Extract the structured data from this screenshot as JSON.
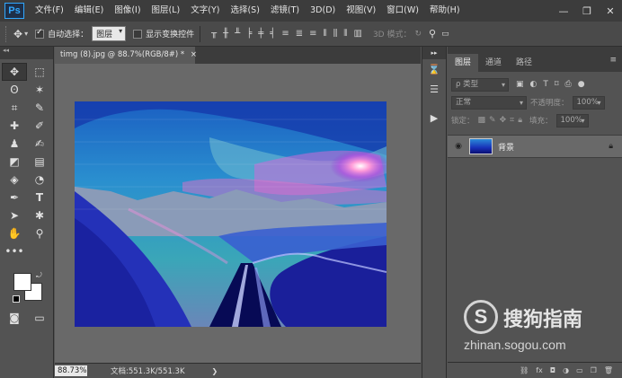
{
  "app": {
    "logo": "Ps"
  },
  "menubar": {
    "items": [
      "文件(F)",
      "编辑(E)",
      "图像(I)",
      "图层(L)",
      "文字(Y)",
      "选择(S)",
      "滤镜(T)",
      "3D(D)",
      "视图(V)",
      "窗口(W)",
      "帮助(H)"
    ],
    "min": "—",
    "restore": "❐",
    "close": "✕"
  },
  "options": {
    "auto_select_label": "自动选择：",
    "auto_select_checked": true,
    "auto_select_target": "图层",
    "show_transform_label": "显示变换控件",
    "show_transform_checked": false,
    "mode3d_label": "3D 模式："
  },
  "document": {
    "tab_title": "timg (8).jpg @ 88.7%(RGB/8#) *",
    "close_glyph": "×",
    "zoom": "88.73%",
    "doc_info": "文档:551.3K/551.3K",
    "arrow": "❯"
  },
  "layers_panel": {
    "tabs": [
      "图层",
      "通道",
      "路径"
    ],
    "active_tab": 0,
    "filter_label": "ρ 类型",
    "blend_mode": "正常",
    "opacity_label": "不透明度：",
    "opacity_value": "100%",
    "lock_label": "锁定：",
    "fill_label": "填充：",
    "fill_value": "100%",
    "layers": [
      {
        "name": "背景",
        "visible": true,
        "locked": true
      }
    ]
  },
  "watermark": {
    "logo_letter": "S",
    "cn": "搜狗指南",
    "url": "zhinan.sogou.com"
  }
}
